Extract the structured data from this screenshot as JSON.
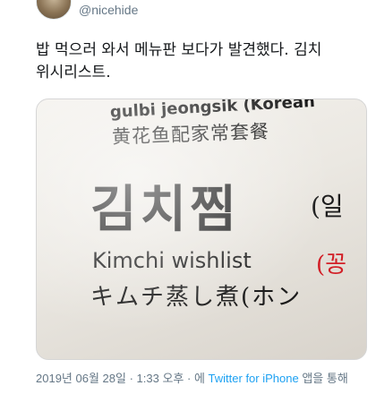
{
  "user": {
    "handle": "@nicehide"
  },
  "tweet": {
    "text_line1": "밥 먹으러 와서 메뉴판 보다가 발견했다. 김치",
    "text_line2": "위시리스트."
  },
  "photo": {
    "romanized": "gulbi jeongsik (Korean",
    "chinese": "黄花鱼配家常套餐",
    "korean_big": "김치찜",
    "korean_side": "(일",
    "english": "Kimchi wishlist",
    "red_text": "(꽁",
    "japanese": "キムチ蒸し煮(ホン"
  },
  "meta": {
    "date": "2019년 06월 28일",
    "time": "1:33 오후",
    "via_prefix": "에",
    "source": "Twitter for iPhone",
    "via_suffix": "앱을 통해"
  }
}
